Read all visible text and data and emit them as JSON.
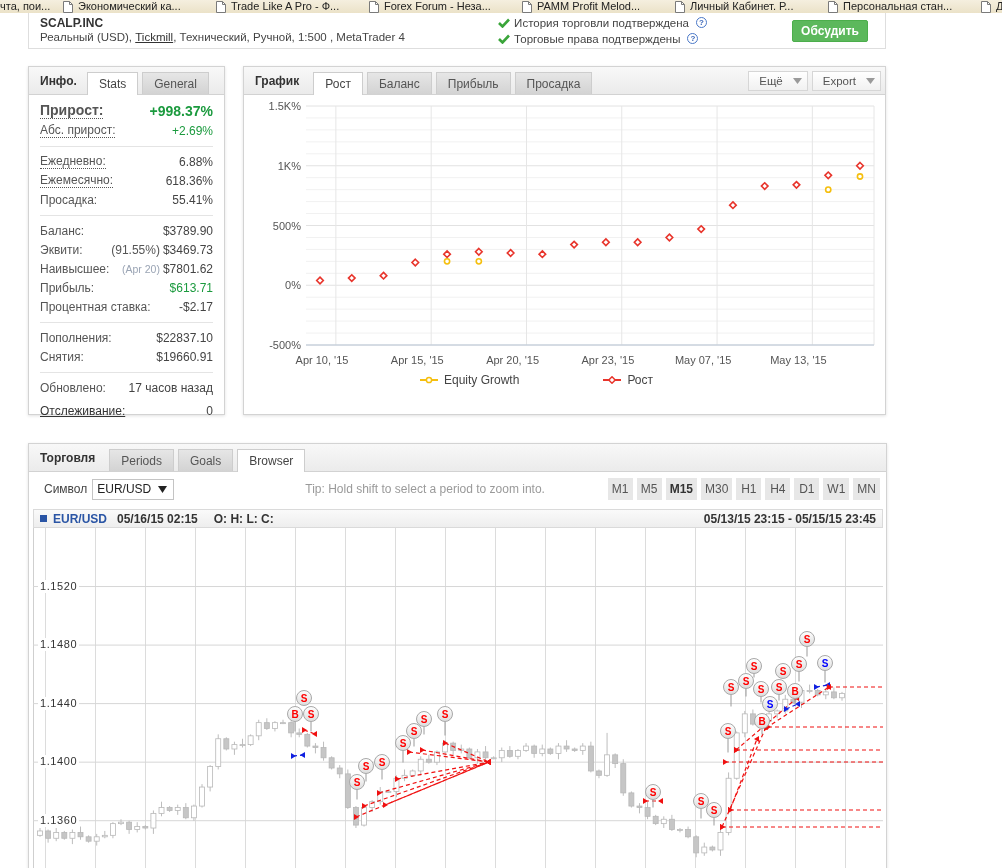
{
  "bookmarks": [
    {
      "label": "чта, пои...",
      "icon": false
    },
    {
      "label": "Экономический ка...",
      "icon": true
    },
    {
      "label": "Trade Like A Pro - Ф...",
      "icon": true
    },
    {
      "label": "Forex Forum - Неза...",
      "icon": true
    },
    {
      "label": "PAMM Profit Melod...",
      "icon": true
    },
    {
      "label": "Личный Кабинет. Р...",
      "icon": true
    },
    {
      "label": "Персональная стан...",
      "icon": true
    },
    {
      "label": "Д",
      "icon": true
    }
  ],
  "account": {
    "name": "SCALP.INC",
    "details_prefix": "Реальный (USD), ",
    "broker": "Tickmill",
    "details_suffix": ", Технический, Ручной, 1:500 , MetaTrader 4",
    "verifications": [
      {
        "label": "История торговли подтверждена",
        "verified": true,
        "help": "?"
      },
      {
        "label": "Торговые права подтверждены",
        "verified": true,
        "help": "?"
      }
    ],
    "discuss_button": "Обсудить"
  },
  "info_panel": {
    "title": "Инфо.",
    "tabs": [
      {
        "label": "Stats",
        "selected": true
      },
      {
        "label": "General",
        "selected": false
      }
    ],
    "groups": [
      [
        {
          "kind": "headline",
          "label": "Прирост:",
          "hint": true,
          "link": false,
          "value": "+998.37%",
          "positive": true
        },
        {
          "kind": "row",
          "label": "Абс. прирост:",
          "hint": true,
          "link": false,
          "value": "+2.69%",
          "positive": true
        }
      ],
      [
        {
          "kind": "row",
          "label": "Ежедневно:",
          "hint": true,
          "link": false,
          "value": "6.88%",
          "positive": false
        },
        {
          "kind": "row",
          "label": "Ежемесячно:",
          "hint": true,
          "link": false,
          "value": "618.36%",
          "positive": false
        },
        {
          "kind": "row",
          "label": "Просадка:",
          "hint": false,
          "link": false,
          "value": "55.41%",
          "positive": false
        }
      ],
      [
        {
          "kind": "row",
          "label": "Баланс:",
          "hint": false,
          "link": false,
          "value": "$3789.90",
          "positive": false
        },
        {
          "kind": "row",
          "label": "Эквити:",
          "hint": false,
          "link": false,
          "note": "(91.55%)",
          "note_muted": false,
          "value": "$3469.73",
          "positive": false
        },
        {
          "kind": "row",
          "label": "Наивысшее:",
          "hint": false,
          "link": false,
          "note": "(Apr 20)",
          "note_muted": true,
          "value": "$7801.62",
          "positive": false
        },
        {
          "kind": "row",
          "label": "Прибыль:",
          "hint": false,
          "link": false,
          "value": "$613.71",
          "positive": true
        },
        {
          "kind": "row",
          "label": "Процентная ставка:",
          "hint": false,
          "link": false,
          "value": "-$2.17",
          "positive": false
        }
      ],
      [
        {
          "kind": "row",
          "label": "Пополнения:",
          "hint": false,
          "link": false,
          "value": "$22837.10",
          "positive": false
        },
        {
          "kind": "row",
          "label": "Снятия:",
          "hint": false,
          "link": false,
          "value": "$19660.91",
          "positive": false
        }
      ],
      [
        {
          "kind": "row",
          "label": "Обновлено:",
          "hint": false,
          "link": false,
          "value": "17 часов назад",
          "positive": false
        },
        {
          "kind": "row",
          "label": "Отслеживание:",
          "hint": false,
          "link": true,
          "value": "0",
          "positive": false
        }
      ]
    ]
  },
  "chart_panel": {
    "title": "График",
    "tabs": [
      {
        "label": "Рост",
        "selected": true
      },
      {
        "label": "Баланс",
        "selected": false
      },
      {
        "label": "Прибыль",
        "selected": false
      },
      {
        "label": "Просадка",
        "selected": false
      }
    ],
    "menus": [
      {
        "label": "Ещё"
      },
      {
        "label": "Export"
      }
    ],
    "chart_data": {
      "type": "scatter",
      "categories": [
        "Apr 10, '15",
        null,
        null,
        "Apr 15, '15",
        null,
        null,
        "Apr 20, '15",
        null,
        null,
        "Apr 23, '15",
        null,
        null,
        "May 07, '15",
        null,
        null,
        "May 13, '15",
        null,
        null
      ],
      "ylim": [
        -500,
        1500
      ],
      "yticks": [
        {
          "value": -500,
          "label": "-500%"
        },
        {
          "value": 0,
          "label": "0%"
        },
        {
          "value": 500,
          "label": "500%"
        },
        {
          "value": 1000,
          "label": "1K%"
        },
        {
          "value": 1500,
          "label": "1.5K%"
        }
      ],
      "grid": true,
      "legend": "bottom",
      "series": [
        {
          "name": "Equity Growth",
          "color": "#f5bf0f",
          "values": [
            null,
            null,
            null,
            null,
            200,
            200,
            null,
            null,
            null,
            null,
            null,
            null,
            null,
            null,
            null,
            null,
            800,
            910
          ]
        },
        {
          "name": "Рост",
          "color": "#e8342b",
          "values": [
            40,
            60,
            80,
            190,
            260,
            280,
            270,
            260,
            340,
            360,
            360,
            400,
            470,
            670,
            830,
            840,
            920,
            1000
          ]
        }
      ]
    }
  },
  "trading_panel": {
    "title": "Торговля",
    "tabs": [
      {
        "label": "Periods",
        "selected": false
      },
      {
        "label": "Goals",
        "selected": false
      },
      {
        "label": "Browser",
        "selected": true
      }
    ],
    "symbol_label": "Символ",
    "symbol": "EUR/USD",
    "tip": "Tip: Hold shift to select a period to zoom into.",
    "timeframes": [
      {
        "label": "M1",
        "selected": false
      },
      {
        "label": "M5",
        "selected": false
      },
      {
        "label": "M15",
        "selected": true
      },
      {
        "label": "M30",
        "selected": false
      },
      {
        "label": "H1",
        "selected": false
      },
      {
        "label": "H4",
        "selected": false
      },
      {
        "label": "D1",
        "selected": false
      },
      {
        "label": "W1",
        "selected": false
      },
      {
        "label": "MN",
        "selected": false
      }
    ],
    "price_chart": {
      "symbol": "EUR/USD",
      "time": "05/16/15 02:15",
      "ohlc": "O: H: L: C:",
      "range": "05/13/15 23:15 - 05/15/15 23:45",
      "chart_data": {
        "type": "candlestick",
        "categories": [
          null,
          null,
          null,
          null,
          null,
          null,
          null,
          null,
          null,
          null,
          null,
          null,
          null,
          null,
          null,
          null,
          null,
          null,
          null,
          null,
          null,
          null,
          null,
          null,
          null,
          null,
          null,
          null,
          null,
          null,
          null,
          null,
          null,
          null,
          null,
          null,
          null,
          null,
          null,
          null,
          null,
          null,
          null,
          null,
          null,
          null,
          null,
          null,
          null,
          null,
          null,
          null,
          null,
          null,
          null,
          null,
          null,
          null,
          null,
          null,
          null,
          null,
          null,
          null,
          null,
          null,
          null,
          null,
          null,
          null,
          null,
          null,
          null,
          null,
          null,
          null,
          null,
          null,
          null,
          null,
          null,
          null,
          null,
          null,
          null,
          null,
          null,
          null,
          null,
          null,
          null,
          null,
          null,
          null,
          null,
          null,
          null,
          null,
          null,
          null
        ],
        "ylim": [
          1.1327,
          1.156
        ],
        "yticks": [
          {
            "value": 1.152,
            "label": "1.1520"
          },
          {
            "value": 1.148,
            "label": "1.1480"
          },
          {
            "value": 1.144,
            "label": "1.1440"
          },
          {
            "value": 1.14,
            "label": "1.1400"
          },
          {
            "value": 1.136,
            "label": "1.1360"
          }
        ],
        "grid": true,
        "ohlc": [
          [
            1.135,
            1.1355,
            1.1349,
            1.1353
          ],
          [
            1.1353,
            1.1354,
            1.1345,
            1.1348
          ],
          [
            1.1348,
            1.1355,
            1.1346,
            1.1352
          ],
          [
            1.1352,
            1.1353,
            1.1347,
            1.1348
          ],
          [
            1.1348,
            1.1354,
            1.1344,
            1.1352
          ],
          [
            1.1352,
            1.1356,
            1.1347,
            1.1349
          ],
          [
            1.1349,
            1.135,
            1.1345,
            1.1346
          ],
          [
            1.1346,
            1.1351,
            1.1343,
            1.1349
          ],
          [
            1.1349,
            1.1353,
            1.1348,
            1.135
          ],
          [
            1.135,
            1.1359,
            1.1348,
            1.1358
          ],
          [
            1.1358,
            1.1361,
            1.1357,
            1.1359
          ],
          [
            1.1359,
            1.136,
            1.1351,
            1.1354
          ],
          [
            1.1354,
            1.1359,
            1.1352,
            1.1356
          ],
          [
            1.1356,
            1.1357,
            1.1354,
            1.1355
          ],
          [
            1.1355,
            1.1367,
            1.1351,
            1.1365
          ],
          [
            1.1365,
            1.1373,
            1.1363,
            1.1369
          ],
          [
            1.1369,
            1.137,
            1.1366,
            1.1367
          ],
          [
            1.1367,
            1.1371,
            1.1364,
            1.1369
          ],
          [
            1.1369,
            1.1372,
            1.1361,
            1.1362
          ],
          [
            1.1362,
            1.1371,
            1.136,
            1.137
          ],
          [
            1.137,
            1.1385,
            1.1369,
            1.1383
          ],
          [
            1.1383,
            1.1398,
            1.138,
            1.1397
          ],
          [
            1.1397,
            1.1419,
            1.1395,
            1.1416
          ],
          [
            1.1416,
            1.1417,
            1.1408,
            1.1409
          ],
          [
            1.1409,
            1.1414,
            1.1405,
            1.1412
          ],
          [
            1.1412,
            1.1416,
            1.141,
            1.1412
          ],
          [
            1.1412,
            1.1419,
            1.1411,
            1.1418
          ],
          [
            1.1418,
            1.1429,
            1.1415,
            1.1427
          ],
          [
            1.1427,
            1.143,
            1.1422,
            1.1423
          ],
          [
            1.1423,
            1.1428,
            1.1421,
            1.1427
          ],
          [
            1.1427,
            1.1429,
            1.1426,
            1.1427
          ],
          [
            1.1427,
            1.1428,
            1.1417,
            1.142
          ],
          [
            1.142,
            1.1423,
            1.1417,
            1.1419
          ],
          [
            1.1419,
            1.142,
            1.141,
            1.1411
          ],
          [
            1.1411,
            1.1413,
            1.1406,
            1.141
          ],
          [
            1.141,
            1.1414,
            1.1401,
            1.1403
          ],
          [
            1.1403,
            1.1404,
            1.1395,
            1.1396
          ],
          [
            1.1396,
            1.1398,
            1.1389,
            1.1392
          ],
          [
            1.1392,
            1.1395,
            1.1368,
            1.1369
          ],
          [
            1.1369,
            1.137,
            1.1355,
            1.1357
          ],
          [
            1.1357,
            1.1371,
            1.1356,
            1.1369
          ],
          [
            1.1369,
            1.1374,
            1.1366,
            1.1373
          ],
          [
            1.1373,
            1.1383,
            1.1371,
            1.138
          ],
          [
            1.138,
            1.1381,
            1.1379,
            1.138
          ],
          [
            1.138,
            1.1391,
            1.1376,
            1.1389
          ],
          [
            1.1389,
            1.1395,
            1.1387,
            1.1391
          ],
          [
            1.1391,
            1.1395,
            1.139,
            1.1394
          ],
          [
            1.1394,
            1.1404,
            1.1391,
            1.1402
          ],
          [
            1.1402,
            1.1405,
            1.1399,
            1.14
          ],
          [
            1.14,
            1.1408,
            1.1398,
            1.1407
          ],
          [
            1.1407,
            1.1415,
            1.1406,
            1.1413
          ],
          [
            1.1413,
            1.1414,
            1.1405,
            1.1408
          ],
          [
            1.1408,
            1.1412,
            1.1406,
            1.1409
          ],
          [
            1.1409,
            1.141,
            1.1402,
            1.1403
          ],
          [
            1.1403,
            1.1409,
            1.1399,
            1.1407
          ],
          [
            1.1407,
            1.1411,
            1.1401,
            1.1403
          ],
          [
            1.1403,
            1.1404,
            1.1402,
            1.1403
          ],
          [
            1.1403,
            1.141,
            1.14,
            1.1408
          ],
          [
            1.1408,
            1.1411,
            1.1403,
            1.1404
          ],
          [
            1.1404,
            1.1409,
            1.1402,
            1.1408
          ],
          [
            1.1408,
            1.1413,
            1.1407,
            1.1411
          ],
          [
            1.1411,
            1.1412,
            1.1403,
            1.1406
          ],
          [
            1.1406,
            1.1412,
            1.1404,
            1.1409
          ],
          [
            1.1409,
            1.141,
            1.1405,
            1.1406
          ],
          [
            1.1406,
            1.1413,
            1.1402,
            1.1411
          ],
          [
            1.1411,
            1.1415,
            1.1407,
            1.1409
          ],
          [
            1.1409,
            1.141,
            1.1407,
            1.1408
          ],
          [
            1.1408,
            1.1413,
            1.1405,
            1.1411
          ],
          [
            1.1411,
            1.1414,
            1.1393,
            1.1394
          ],
          [
            1.1394,
            1.1395,
            1.1389,
            1.1391
          ],
          [
            1.1391,
            1.142,
            1.139,
            1.1405
          ],
          [
            1.1405,
            1.1406,
            1.1396,
            1.1399
          ],
          [
            1.1399,
            1.1402,
            1.1377,
            1.1379
          ],
          [
            1.1379,
            1.138,
            1.1369,
            1.137
          ],
          [
            1.137,
            1.1372,
            1.1365,
            1.1369
          ],
          [
            1.1369,
            1.1373,
            1.1361,
            1.1363
          ],
          [
            1.1363,
            1.1364,
            1.1357,
            1.1358
          ],
          [
            1.1358,
            1.1363,
            1.1355,
            1.1361
          ],
          [
            1.1361,
            1.1364,
            1.1353,
            1.1354
          ],
          [
            1.1354,
            1.1355,
            1.1352,
            1.1354
          ],
          [
            1.1354,
            1.1356,
            1.1348,
            1.1349
          ],
          [
            1.1349,
            1.135,
            1.1335,
            1.1338
          ],
          [
            1.1338,
            1.1345,
            1.1336,
            1.1342
          ],
          [
            1.1342,
            1.1343,
            1.1339,
            1.134
          ],
          [
            1.134,
            1.1354,
            1.1336,
            1.1352
          ],
          [
            1.1352,
            1.1393,
            1.135,
            1.1389
          ],
          [
            1.1389,
            1.1421,
            1.1388,
            1.142
          ],
          [
            1.142,
            1.1435,
            1.1417,
            1.1433
          ],
          [
            1.1433,
            1.1436,
            1.1425,
            1.1426
          ],
          null,
          [
            1.1428,
            1.1435,
            1.1427,
            1.1433
          ],
          [
            1.1433,
            1.1436,
            1.143,
            1.1435
          ],
          [
            1.1435,
            1.1446,
            1.1433,
            1.1443
          ],
          [
            1.1443,
            1.1444,
            1.144,
            1.1441
          ],
          [
            1.1441,
            1.1451,
            1.1437,
            1.1449
          ],
          [
            1.1449,
            1.1453,
            1.1447,
            1.1449
          ],
          [
            1.1449,
            1.145,
            1.1445,
            1.1446
          ],
          [
            1.1446,
            1.145,
            1.1443,
            1.1448
          ],
          [
            1.1448,
            1.1451,
            1.1443,
            1.1444
          ],
          [
            1.1444,
            1.1448,
            1.1442,
            1.1447
          ]
        ]
      },
      "trades": [
        {
          "label": "S",
          "color": "#ff0000"
        },
        {
          "label": "B",
          "color": "#ff0000"
        },
        {
          "label": "S",
          "color": "#ff0000"
        },
        {
          "label": "S",
          "color": "#ff0000"
        },
        {
          "label": "S",
          "color": "#ff0000"
        },
        {
          "label": "S",
          "color": "#ff0000"
        },
        {
          "label": "S",
          "color": "#ff0000"
        },
        {
          "label": "S",
          "color": "#ff0000"
        },
        {
          "label": "S",
          "color": "#ff0000"
        },
        {
          "label": "S",
          "color": "#ff0000"
        },
        {
          "label": "S",
          "color": "#ff0000"
        },
        {
          "label": "S",
          "color": "#ff0000"
        },
        {
          "label": "S",
          "color": "#ff0000"
        },
        {
          "label": "S",
          "color": "#ff0000"
        },
        {
          "label": "S",
          "color": "#ff0000"
        },
        {
          "label": "S",
          "color": "#ff0000"
        },
        {
          "label": "S",
          "color": "#ff0000"
        },
        {
          "label": "S",
          "color": "#ff0000"
        },
        {
          "label": "S",
          "color": "#0000ff"
        },
        {
          "label": "B",
          "color": "#ff0000"
        },
        {
          "label": "S",
          "color": "#ff0000"
        },
        {
          "label": "S",
          "color": "#ff0000"
        },
        {
          "label": "B",
          "color": "#ff0000"
        },
        {
          "label": "S",
          "color": "#ff0000"
        },
        {
          "label": "S",
          "color": "#ff0000"
        },
        {
          "label": "S",
          "color": "#0000ff"
        }
      ]
    }
  }
}
